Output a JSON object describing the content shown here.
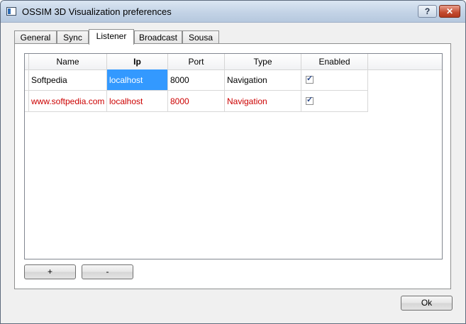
{
  "window": {
    "title": "OSSIM 3D Visualization preferences",
    "help_label": "?",
    "close_label": "✕"
  },
  "tabs": [
    {
      "label": "General"
    },
    {
      "label": "Sync"
    },
    {
      "label": "Listener",
      "active": true
    },
    {
      "label": "Broadcast"
    },
    {
      "label": "Sousa"
    }
  ],
  "table": {
    "columns": [
      "Name",
      "Ip",
      "Port",
      "Type",
      "Enabled"
    ],
    "sorted_column": "Ip",
    "rows": [
      {
        "name": "Softpedia",
        "ip": "localhost",
        "port": "8000",
        "type": "Navigation",
        "enabled": true,
        "highlight": "none",
        "selected_cell": "ip"
      },
      {
        "name": "www.softpedia.com",
        "ip": "localhost",
        "port": "8000",
        "type": "Navigation",
        "enabled": true,
        "highlight": "red"
      }
    ]
  },
  "buttons": {
    "add_label": "+",
    "remove_label": "-",
    "ok_label": "Ok"
  },
  "colors": {
    "selection": "#3399ff",
    "error_text": "#cc0000",
    "titlebar": "#c3d3e6"
  }
}
